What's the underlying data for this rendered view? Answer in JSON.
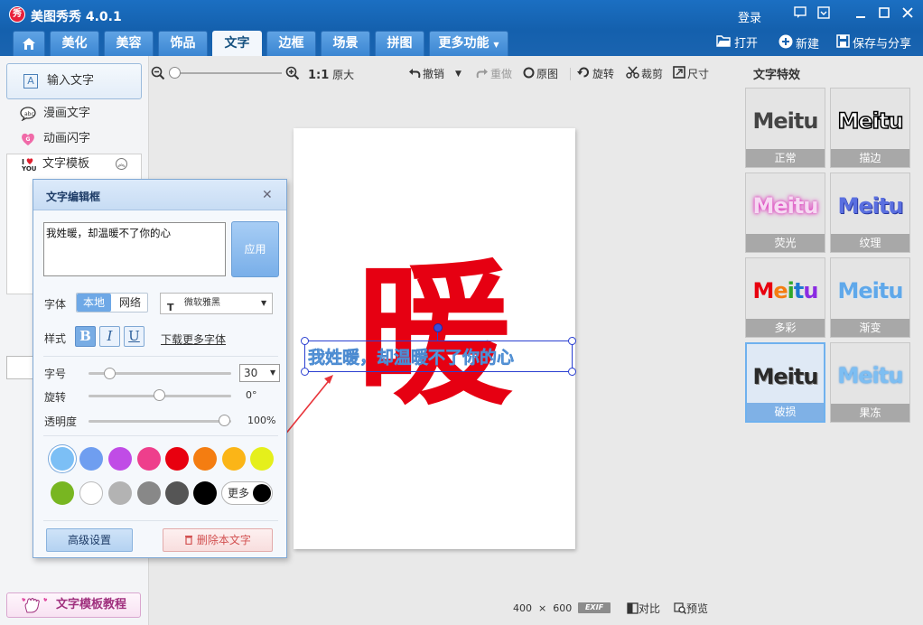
{
  "app": {
    "title": "美图秀秀 4.0.1",
    "logo_text": "秀"
  },
  "titlebar": {
    "login": "登录"
  },
  "tabs": [
    "美化",
    "美容",
    "饰品",
    "文字",
    "边框",
    "场景",
    "拼图"
  ],
  "tab_more": "更多功能",
  "top_actions": {
    "open": "打开",
    "new": "新建",
    "save_share": "保存与分享"
  },
  "left_panel": {
    "input_text": "输入文字",
    "comic_text": "漫画文字",
    "animated_text": "动画闪字",
    "text_template": "文字模板",
    "tutorial": "文字模板教程"
  },
  "toolbar": {
    "ratio": "1:1",
    "original_size": "原大",
    "undo": "撤销",
    "redo": "重做",
    "original": "原图",
    "rotate": "旋转",
    "crop": "裁剪",
    "size": "尺寸"
  },
  "canvas": {
    "big_char": "暖",
    "overlay_text": "我姓暖，却温暖不了你的心"
  },
  "dialog": {
    "title": "文字编辑框",
    "content": "我姓暖，却温暖不了你的心",
    "apply": "应用",
    "font_label": "字体",
    "font_local": "本地",
    "font_web": "网络",
    "font_name": "微软雅黑",
    "style_label": "样式",
    "bold": "B",
    "italic": "I",
    "underline": "U",
    "download_fonts": "下载更多字体",
    "size_label": "字号",
    "size_value": "30",
    "rotate_label": "旋转",
    "rotate_value": "0°",
    "opacity_label": "透明度",
    "opacity_value": "100%",
    "more_colors": "更多",
    "advanced": "高级设置",
    "delete": "删除本文字",
    "colors": [
      "#7cbff5",
      "#6f9ef0",
      "#c04ce6",
      "#ee3f8c",
      "#e8000f",
      "#f47d11",
      "#fbb517",
      "#e5ef1b",
      "#78b621",
      "#ffffff",
      "#b3b3b3",
      "#888888",
      "#555555",
      "#000000"
    ],
    "selected_color": "#7cbff5"
  },
  "right_panel": {
    "title": "文字特效",
    "effects": [
      {
        "label": "正常",
        "preview": "Meitu"
      },
      {
        "label": "描边",
        "preview": "Meitu"
      },
      {
        "label": "荧光",
        "preview": "Meitu"
      },
      {
        "label": "纹理",
        "preview": "Meitu"
      },
      {
        "label": "多彩",
        "preview": "Meitu"
      },
      {
        "label": "渐变",
        "preview": "Meitu"
      },
      {
        "label": "破损",
        "preview": "Meitu"
      },
      {
        "label": "果冻",
        "preview": "Meitu"
      }
    ]
  },
  "status": {
    "width": "400",
    "times": "×",
    "height": "600",
    "exif": "EXIF",
    "compare": "对比",
    "preview": "预览"
  }
}
